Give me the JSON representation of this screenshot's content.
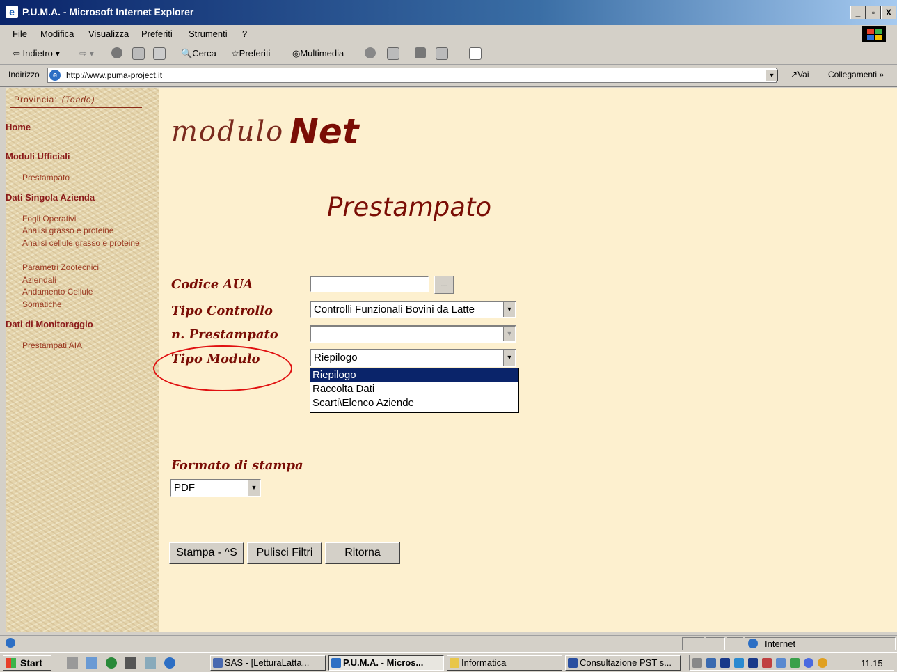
{
  "window": {
    "title": "P.U.M.A. - Microsoft Internet Explorer",
    "controls": [
      "_",
      "▫",
      "X"
    ]
  },
  "menu": [
    "File",
    "Modifica",
    "Visualizza",
    "Preferiti",
    "Strumenti",
    "?"
  ],
  "toolbar": {
    "back": "Indietro",
    "search": "Cerca",
    "favorites": "Preferiti",
    "media": "Multimedia"
  },
  "address": {
    "label": "Indirizzo",
    "url": "http://www.puma-project.it",
    "go": "Vai",
    "links": "Collegamenti"
  },
  "sidebar": {
    "provincia_label": "Provincia:",
    "provincia_value": "(Tondo)",
    "home": "Home",
    "section1": "Moduli Ufficiali",
    "section1_links": [
      "Prestampato"
    ],
    "section2": "Dati Singola Azienda",
    "section2_links": [
      "Fogli Operativi",
      "Analisi grasso e proteine",
      "Analisi cellule grasso e proteine",
      "Parametri Zootecnici Aziendali",
      "Andamento Cellule Somatiche"
    ],
    "section3": "Dati di Monitoraggio",
    "section3_links": [
      "Prestampati AIA"
    ]
  },
  "logo": {
    "part1": "modulo",
    "part2": "Net"
  },
  "page_title": "Prestampato",
  "form": {
    "codice_label": "Codice AUA",
    "codice_value": "",
    "browse_button": "...",
    "tipo_controllo_label": "Tipo Controllo",
    "tipo_controllo_value": "Controlli Funzionali Bovini da Latte",
    "n_prestampato_label": "n. Prestampato",
    "n_prestampato_value": "",
    "tipo_modulo_label": "Tipo Modulo",
    "tipo_modulo_value": "Riepilogo",
    "tipo_modulo_options": [
      "Riepilogo",
      "Raccolta Dati",
      "Scarti\\Elenco Aziende"
    ],
    "tipo_modulo_highlighted": "Riepilogo",
    "formato_label": "Formato di stampa",
    "formato_value": "PDF"
  },
  "buttons": {
    "stampa": "Stampa - ^S",
    "pulisci": "Pulisci Filtri",
    "ritorna": "Ritorna"
  },
  "statusbar": {
    "zone": "Internet"
  },
  "taskbar": {
    "start": "Start",
    "tasks": [
      "SAS - [LetturaLatta...",
      "P.U.M.A. - Micros...",
      "Informatica",
      "Consultazione PST s..."
    ],
    "clock": "11.15"
  }
}
